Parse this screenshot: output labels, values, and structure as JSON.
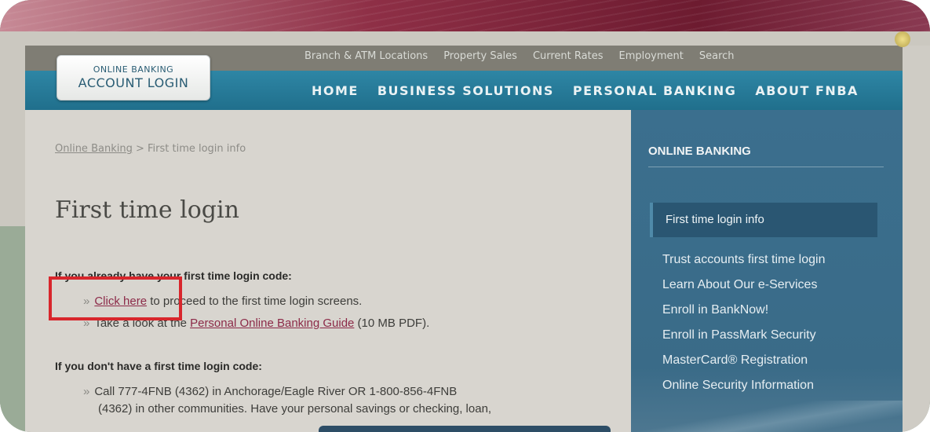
{
  "header": {
    "login": {
      "small": "ONLINE BANKING",
      "big": "ACCOUNT LOGIN"
    },
    "util_nav": [
      "Branch & ATM Locations",
      "Property Sales",
      "Current Rates",
      "Employment",
      "Search"
    ],
    "main_nav": [
      "HOME",
      "BUSINESS SOLUTIONS",
      "PERSONAL BANKING",
      "ABOUT FNBA"
    ]
  },
  "breadcrumb": {
    "link": "Online Banking",
    "separator": " > ",
    "current": "First time login info"
  },
  "page": {
    "title": "First time login",
    "section1_heading": "If you already have your first time login code:",
    "bullet1_link": "Click here",
    "bullet1_text": " to proceed to the first time login screens.",
    "bullet2_prefix": "Take a look at the ",
    "bullet2_link": "Personal Online Banking Guide",
    "bullet2_suffix": " (10 MB PDF).",
    "section2_heading": "If you don't have a first time login code:",
    "bullet3_line1": "Call 777-4FNB (4362) in Anchorage/Eagle River OR 1-800-856-4FNB",
    "bullet3_line2": "(4362) in other communities. Have your personal savings or checking, loan,",
    "raquo": "»"
  },
  "sidebar": {
    "title": "ONLINE BANKING",
    "active": "First time login info",
    "links": [
      "Trust accounts first time login",
      "Learn About Our e-Services",
      "Enroll in BankNow!",
      "Enroll in PassMark Security",
      "MasterCard® Registration",
      "Online Security Information"
    ]
  }
}
